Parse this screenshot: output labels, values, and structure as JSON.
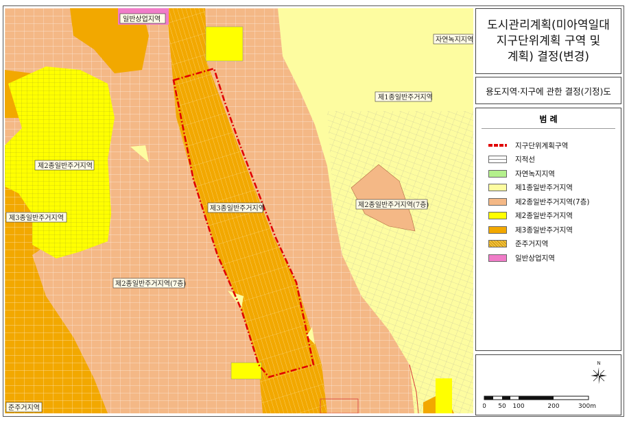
{
  "title": "도시관리계획(미아역일대\n지구단위계획 구역 및\n계획) 결정(변경)",
  "subtitle": "용도지역·지구에 관한 결정(기정)도",
  "legend": {
    "heading": "범 례",
    "items": [
      {
        "label": "지구단위계획구역",
        "color": "#e00000",
        "kind": "dashline"
      },
      {
        "label": "지적선",
        "color": "#ffffff",
        "kind": "lines"
      },
      {
        "label": "자연녹지지역",
        "color": "#b4f08c",
        "kind": "fill"
      },
      {
        "label": "제1종일반주거지역",
        "color": "#fdfca0",
        "kind": "fill"
      },
      {
        "label": "제2종일반주거지역(7층)",
        "color": "#f4b886",
        "kind": "fill"
      },
      {
        "label": "제2종일반주거지역",
        "color": "#ffff00",
        "kind": "fill"
      },
      {
        "label": "제3종일반주거지역",
        "color": "#f2a800",
        "kind": "fill"
      },
      {
        "label": "준주거지역",
        "color": "#f0c040",
        "kind": "hatch"
      },
      {
        "label": "일반상업지역",
        "color": "#f07cc8",
        "kind": "fill"
      }
    ]
  },
  "map_labels": {
    "commercial": "일반상업지역",
    "natural_green": "자연녹지지역",
    "res1": "제1종일반주거지역",
    "res2_left": "제2종일반주거지역",
    "res3_left": "제3종일반주거지역",
    "res3_center": "제3종일반주거지역",
    "res2_7_right": "제2종일반주거지역(7층)",
    "res2_7_center": "제2종일반주거지역(7층)",
    "semi_res": "준주거지역"
  },
  "north_label": "N",
  "scale": {
    "ticks": [
      "0",
      "50",
      "100",
      "200",
      "300m"
    ]
  },
  "colors": {
    "res1": "#fdfca0",
    "res2": "#ffff00",
    "res2_7": "#f4b886",
    "res3": "#f2a800",
    "commercial": "#f07cc8",
    "boundary": "#e00000"
  }
}
